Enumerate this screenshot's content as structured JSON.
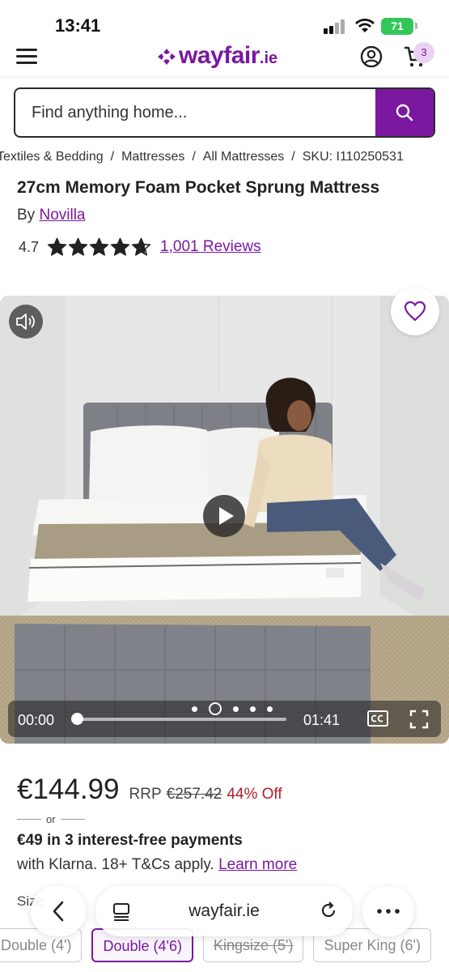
{
  "status_bar": {
    "time": "13:41",
    "battery": "71"
  },
  "header": {
    "logo_text": "wayfair",
    "logo_tld": ".ie",
    "cart_count": "3"
  },
  "search": {
    "placeholder": "Find anything home..."
  },
  "breadcrumb": [
    "Textiles & Bedding",
    "Mattresses",
    "All Mattresses",
    "SKU: I110250531"
  ],
  "product": {
    "title": "27cm Memory Foam Pocket Sprung Mattress",
    "by_label": "By",
    "brand": "Novilla",
    "rating": "4.7",
    "rating_value": 4.7,
    "rating_max": 5,
    "reviews": "1,001 Reviews"
  },
  "video": {
    "current_time": "00:00",
    "total_time": "01:41",
    "progress": 0.0,
    "dot_count": 5,
    "active_dot": 1
  },
  "pricing": {
    "price": "€144.99",
    "rrp_label": "RRP",
    "rrp_value": "€257.42",
    "discount": "44% Off",
    "or": "or",
    "klarna_title": "€49 in 3 interest-free payments",
    "klarna_text": "with Klarna. 18+ T&Cs apply.",
    "learn_more": "Learn more"
  },
  "size": {
    "label": "Size",
    "options": [
      {
        "label": "Double (4')",
        "state": "available"
      },
      {
        "label": "Double (4'6)",
        "state": "selected"
      },
      {
        "label": "Kingsize (5')",
        "state": "unavailable"
      },
      {
        "label": "Super King (6')",
        "state": "available"
      }
    ]
  },
  "browser": {
    "url": "wayfair.ie"
  },
  "colors": {
    "brand_purple": "#7b189f",
    "discount_red": "#b3202a",
    "battery_green": "#33c759"
  },
  "icons": [
    "menu-icon",
    "account-icon",
    "cart-icon",
    "search-icon",
    "star-icon",
    "audio-icon",
    "heart-icon",
    "play-icon",
    "cc-icon",
    "fullscreen-icon",
    "back-icon",
    "tabs-icon",
    "reload-icon",
    "more-icon"
  ]
}
